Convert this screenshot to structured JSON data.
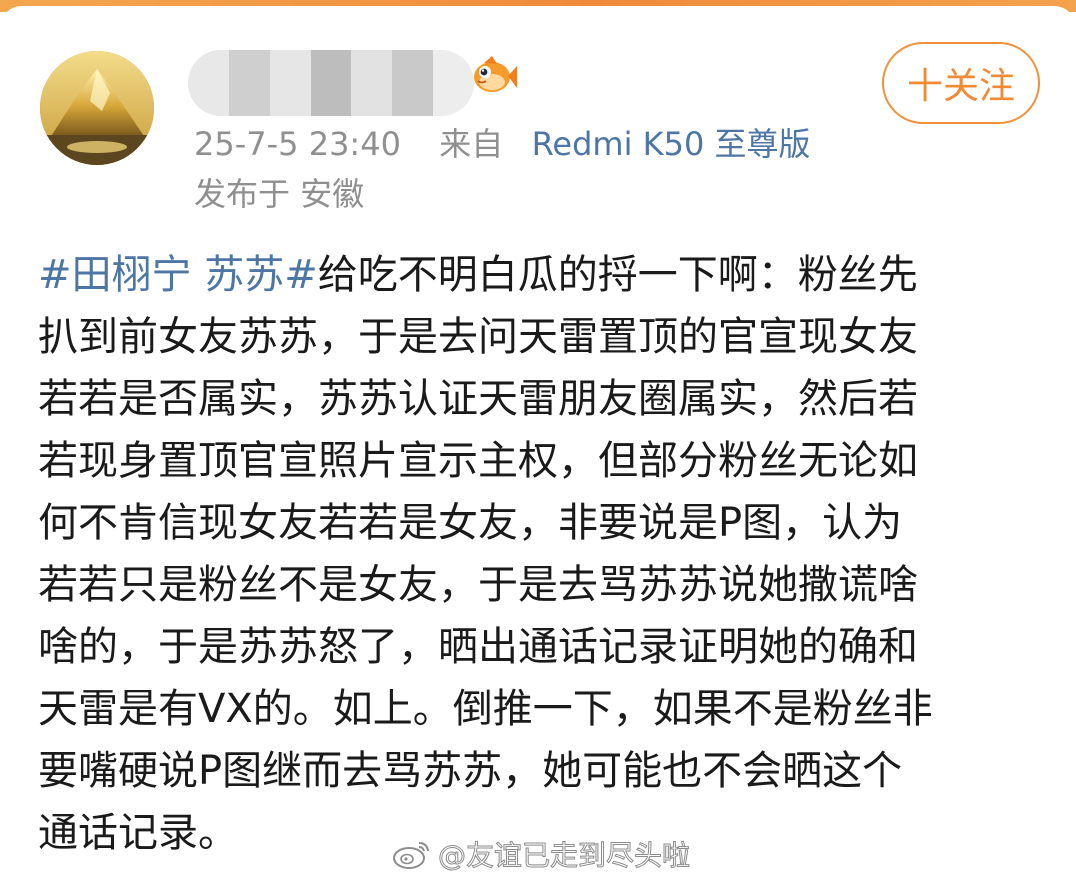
{
  "post": {
    "author": {
      "avatar_icon": "golden-mountain-avatar",
      "username_blurred": true,
      "badge_icon": "orange-fish-icon"
    },
    "follow_label": "十关注",
    "meta": {
      "time": "25-7-5 23:40",
      "source_prefix": "来自",
      "device": "Redmi K50 至尊版"
    },
    "location": "发布于 安徽",
    "content": {
      "hashtag": "#田栩宁 苏苏#",
      "lines": [
        "给吃不明白瓜的捋一下啊：粉丝先",
        "扒到前女友苏苏，于是去问天雷置顶的官宣现女友",
        "若若是否属实，苏苏认证天雷朋友圈属实，然后若",
        "若现身置顶官宣照片宣示主权，但部分粉丝无论如",
        "何不肯信现女友若若是女友，非要说是P图，认为",
        "若若只是粉丝不是女友，于是去骂苏苏说她撒谎啥",
        "啥的，于是苏苏怒了，晒出通话记录证明她的确和",
        "天雷是有VX的。如上。倒推一下，如果不是粉丝非",
        "要嘴硬说P图继而去骂苏苏，她可能也不会晒这个",
        "通话记录。"
      ]
    }
  },
  "watermark": {
    "icon": "weibo-logo-icon",
    "text": "@友谊已走到尽头啦"
  },
  "colors": {
    "accent_orange": "#f08a35",
    "link_blue": "#4d76a5",
    "meta_gray": "#8f8f8f",
    "body_text": "#1a1a1a"
  }
}
